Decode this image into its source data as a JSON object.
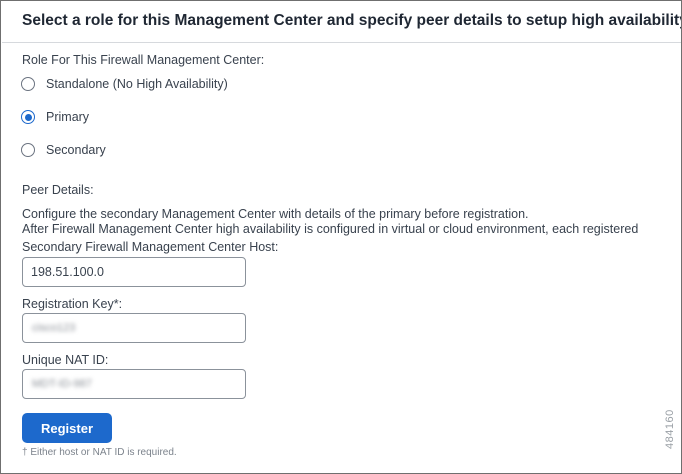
{
  "heading": "Select a role for this Management Center and specify peer details to setup high availability.",
  "role": {
    "label": "Role For This Firewall Management Center:",
    "options": [
      {
        "label": "Standalone (No High Availability)",
        "checked": false
      },
      {
        "label": "Primary",
        "checked": true
      },
      {
        "label": "Secondary",
        "checked": false
      }
    ]
  },
  "peer": {
    "label": "Peer Details:",
    "desc_line1": "Configure the secondary Management Center with details of the primary before registration.",
    "desc_line2": "After Firewall Management Center high availability is configured in virtual or cloud environment, each registered",
    "host_label": "Secondary Firewall Management Center Host:",
    "host_value": "198.51.100.0",
    "key_label": "Registration Key*:",
    "key_value": "cisco123",
    "nat_label": "Unique NAT ID:",
    "nat_value": "MDT-ID-987"
  },
  "register_label": "Register",
  "footnote": "† Either host or NAT ID is required.",
  "figure_id": "484160",
  "colors": {
    "accent": "#1d69cc"
  }
}
